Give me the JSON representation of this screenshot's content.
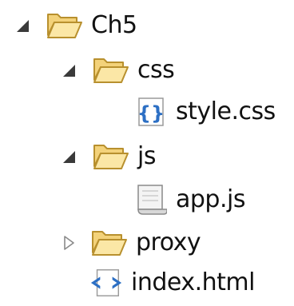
{
  "tree": {
    "root": {
      "label": "Ch5",
      "icon": "folder-open-icon",
      "state": "expanded",
      "children": [
        {
          "label": "css",
          "icon": "folder-open-icon",
          "state": "expanded",
          "children": [
            {
              "label": "style.css",
              "icon": "css-file-icon"
            }
          ]
        },
        {
          "label": "js",
          "icon": "folder-open-icon",
          "state": "expanded",
          "children": [
            {
              "label": "app.js",
              "icon": "script-file-icon"
            }
          ]
        },
        {
          "label": "proxy",
          "icon": "folder-open-icon",
          "state": "collapsed",
          "children": []
        },
        {
          "label": "index.html",
          "icon": "html-file-icon"
        }
      ]
    }
  },
  "colors": {
    "folder_fill": "#f7dc8a",
    "folder_stroke": "#b8902e",
    "css_blue": "#2c6fc4",
    "twisty_expanded": "#3a3a3a",
    "twisty_collapsed": "#8a8a8a"
  }
}
